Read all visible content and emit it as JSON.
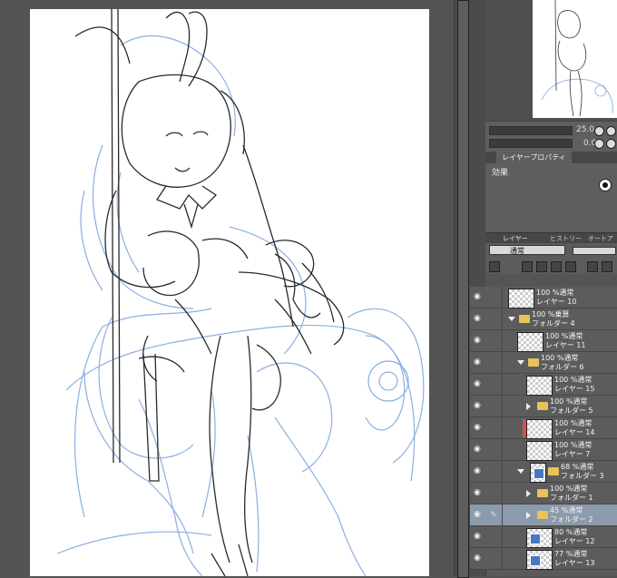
{
  "navigator": {
    "zoom": "25.0"
  },
  "properties": {
    "tab_label": "レイヤープロパティ",
    "effect_label": "効果"
  },
  "layer_panel": {
    "tabs": [
      "レイヤー",
      "ヒストリー",
      "オートアクション"
    ],
    "blend_mode": "通常",
    "layers": [
      {
        "line1": "100 %通常",
        "line2": "レイヤー 10",
        "type": "layer",
        "indent": 0
      },
      {
        "line1": "100 %乗算",
        "line2": "フォルダー 4",
        "type": "folder-open",
        "indent": 0
      },
      {
        "line1": "100 %通常",
        "line2": "レイヤー 11",
        "type": "layer",
        "indent": 1
      },
      {
        "line1": "100 %通常",
        "line2": "フォルダー 6",
        "type": "folder-open",
        "indent": 1
      },
      {
        "line1": "100 %通常",
        "line2": "レイヤー 15",
        "type": "layer",
        "indent": 2
      },
      {
        "line1": "100 %通常",
        "line2": "フォルダー 5",
        "type": "folder-closed",
        "indent": 2
      },
      {
        "line1": "100 %通常",
        "line2": "レイヤー 14",
        "type": "layer-red",
        "indent": 2
      },
      {
        "line1": "100 %通常",
        "line2": "レイヤー 7",
        "type": "layer",
        "indent": 2
      },
      {
        "line1": "68 %通常",
        "line2": "フォルダー 3",
        "type": "folder-open-mask",
        "indent": 1
      },
      {
        "line1": "100 %通常",
        "line2": "フォルダー 1",
        "type": "folder-closed",
        "indent": 2
      },
      {
        "line1": "45 %通常",
        "line2": "フォルダー 2",
        "type": "folder-closed",
        "indent": 2,
        "selected": true
      },
      {
        "line1": "80 %通常",
        "line2": "レイヤー 12",
        "type": "layer-mask",
        "indent": 2
      },
      {
        "line1": "77 %通常",
        "line2": "レイヤー 13",
        "type": "layer-mask",
        "indent": 2
      }
    ]
  },
  "colors": {
    "selected_row": "#8c9bab",
    "sketch_blue": "#7fa7de",
    "sketch_black": "#2a2a2a"
  }
}
